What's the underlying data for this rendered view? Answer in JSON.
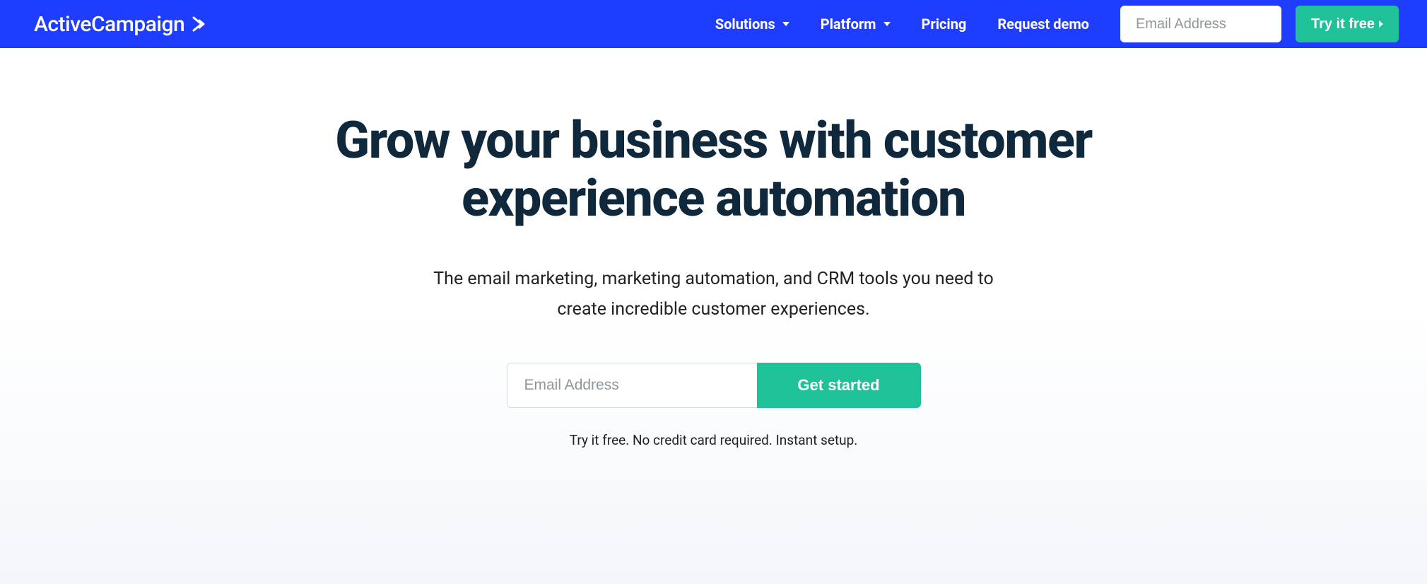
{
  "header": {
    "logo": "ActiveCampaign",
    "nav": {
      "solutions": "Solutions",
      "platform": "Platform",
      "pricing": "Pricing",
      "request_demo": "Request demo"
    },
    "email_placeholder": "Email Address",
    "try_free": "Try it free"
  },
  "hero": {
    "title": "Grow your business with customer experience automation",
    "subtitle": "The email marketing, marketing automation, and CRM tools you need to create incredible customer experiences.",
    "email_placeholder": "Email Address",
    "get_started": "Get started",
    "note": "Try it free. No credit card required. Instant setup."
  }
}
